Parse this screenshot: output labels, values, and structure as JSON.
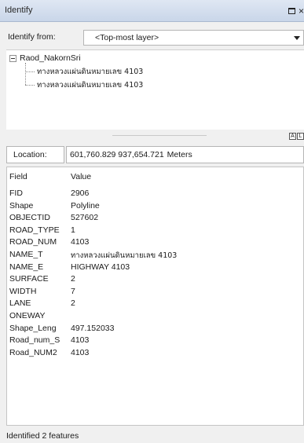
{
  "window": {
    "title": "Identify",
    "restore_glyph": "",
    "close_glyph": "×"
  },
  "identify_from": {
    "label": "Identify from:",
    "selected": "<Top-most layer>"
  },
  "tree": {
    "root": "Raod_NakornSri",
    "children": [
      "ทางหลวงแผ่นดินหมายเลข 4103",
      "ทางหลวงแผ่นดินหมายเลข 4103"
    ]
  },
  "view_icons": [
    "A",
    "L"
  ],
  "location": {
    "label": "Location:",
    "value": "601,760.829 937,654.721",
    "unit": "Meters"
  },
  "attributes": {
    "header_field": "Field",
    "header_value": "Value",
    "rows": [
      {
        "field": "FID",
        "value": "2906"
      },
      {
        "field": "Shape",
        "value": "Polyline"
      },
      {
        "field": "OBJECTID",
        "value": "527602"
      },
      {
        "field": "ROAD_TYPE",
        "value": "1"
      },
      {
        "field": "ROAD_NUM",
        "value": "4103"
      },
      {
        "field": "NAME_T",
        "value": "ทางหลวงแผ่นดินหมายเลข 4103"
      },
      {
        "field": "NAME_E",
        "value": "HIGHWAY 4103"
      },
      {
        "field": "SURFACE",
        "value": "2"
      },
      {
        "field": "WIDTH",
        "value": "7"
      },
      {
        "field": "LANE",
        "value": "2"
      },
      {
        "field": "ONEWAY",
        "value": ""
      },
      {
        "field": "Shape_Leng",
        "value": "497.152033"
      },
      {
        "field": "Road_num_S",
        "value": "4103"
      },
      {
        "field": "Road_NUM2",
        "value": "4103"
      }
    ]
  },
  "status": "Identified 2 features"
}
